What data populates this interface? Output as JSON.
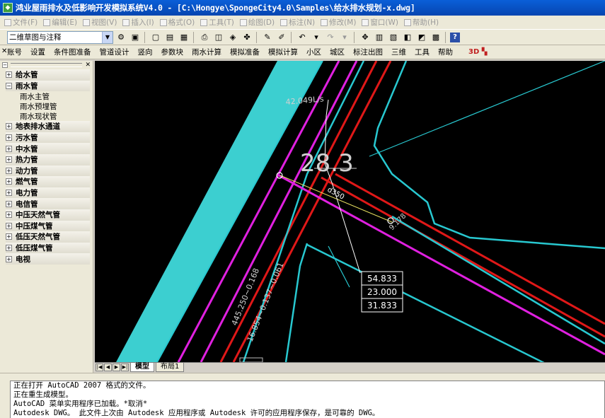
{
  "window": {
    "title": "鸿业屋雨排水及低影响开发模拟系统V4.0 - [C:\\Hongye\\SpongeCity4.0\\Samples\\给水排水规划-x.dwg]"
  },
  "menubar": {
    "items": [
      "文件(F)",
      "编辑(E)",
      "视图(V)",
      "插入(I)",
      "格式(O)",
      "工具(T)",
      "绘图(D)",
      "标注(N)",
      "修改(M)",
      "窗口(W)",
      "帮助(H)"
    ]
  },
  "toolbar": {
    "layer_combo_value": "二维草图与注释"
  },
  "funcmenu": {
    "items": [
      "账号",
      "设置",
      "条件图准备",
      "管道设计",
      "竖向",
      "参数块",
      "雨水计算",
      "模拟准备",
      "模拟计算",
      "小区",
      "城区",
      "标注出图",
      "三维",
      "工具",
      "帮助"
    ]
  },
  "tree": {
    "nodes": [
      {
        "label": "给水管",
        "expanded": false
      },
      {
        "label": "雨水管",
        "expanded": true,
        "children": [
          "雨水主管",
          "雨水预埋管",
          "雨水现状管"
        ]
      },
      {
        "label": "地表排水通道",
        "expanded": false
      },
      {
        "label": "污水管",
        "expanded": false
      },
      {
        "label": "中水管",
        "expanded": false
      },
      {
        "label": "热力管",
        "expanded": false
      },
      {
        "label": "动力管",
        "expanded": false
      },
      {
        "label": "燃气管",
        "expanded": false
      },
      {
        "label": "电力管",
        "expanded": false
      },
      {
        "label": "电信管",
        "expanded": false
      },
      {
        "label": "中压天然气管",
        "expanded": false
      },
      {
        "label": "中压煤气管",
        "expanded": false
      },
      {
        "label": "低压天然气管",
        "expanded": false
      },
      {
        "label": "低压煤气管",
        "expanded": false
      },
      {
        "label": "电视",
        "expanded": false
      }
    ]
  },
  "drawing": {
    "flow_label": "42.049L/s",
    "big_label": "28.3",
    "pipe_label_1": "d350",
    "pipe_label_2": "9.178",
    "elev_box": [
      "54.833",
      "23.000",
      "31.833"
    ],
    "slope_label_1": "445.250~0.168",
    "slope_label_2": "16.854~0.137~0.061"
  },
  "tabs": {
    "model": "模型",
    "layout": "布局1"
  },
  "command": {
    "lines": [
      "正在打开 AutoCAD 2007 格式的文件。",
      "正在重生成模型。",
      "AutoCAD 菜单实用程序已加载。*取消*",
      "Autodesk DWG。  此文件上次由 Autodesk 应用程序或 Autodesk 许可的应用程序保存，是可靠的 DWG。"
    ]
  },
  "colors": {
    "road": "#28c8d0",
    "road_fill": "#3ccfd0",
    "water_pipe": "#e020e0",
    "rain_pipe": "#e01818",
    "canvas_bg": "#000000"
  }
}
